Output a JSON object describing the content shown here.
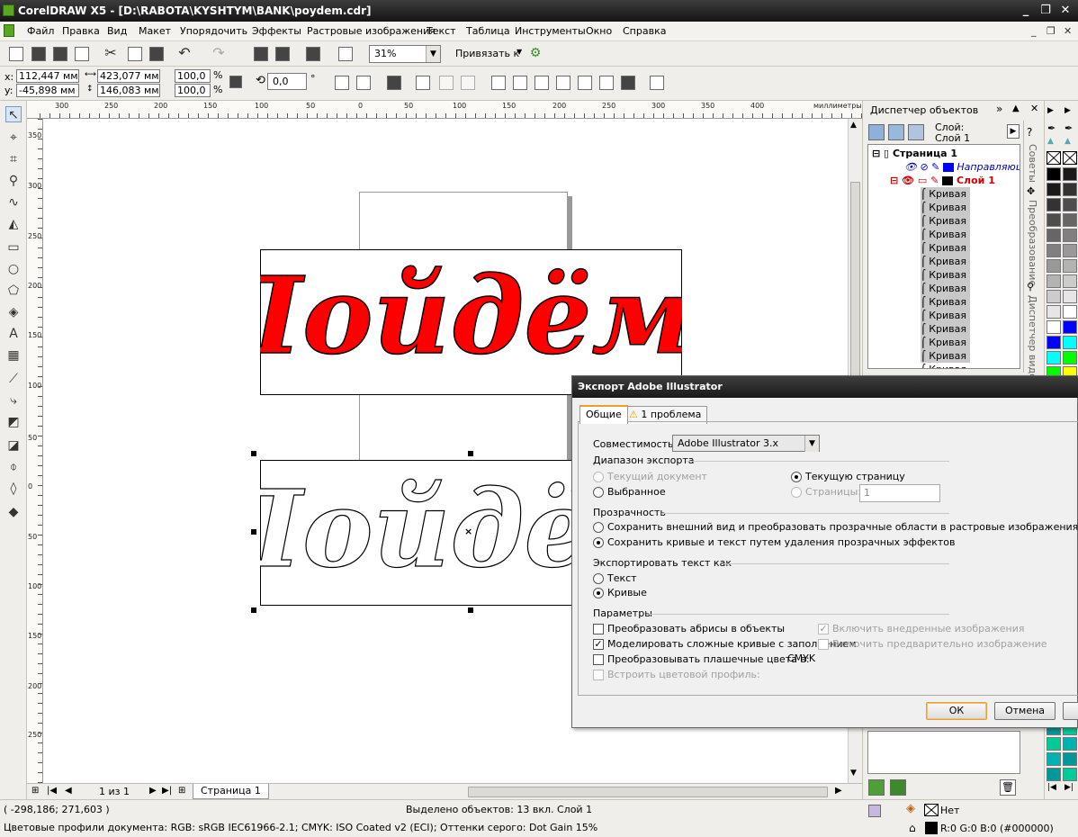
{
  "window": {
    "title": "CorelDRAW X5 - [D:\\RABOTA\\KYSHTYM\\BANK\\poydem.cdr]"
  },
  "menu": [
    "Файл",
    "Правка",
    "Вид",
    "Макет",
    "Упорядочить",
    "Эффекты",
    "Растровые изображения",
    "Текст",
    "Таблица",
    "Инструменты",
    "Окно",
    "Справка"
  ],
  "toolbar": {
    "zoom": "31%",
    "snap_label": "Привязать к"
  },
  "property_bar": {
    "x": "112,447 мм",
    "y": "-45,898 мм",
    "width": "423,077 мм",
    "height": "146,083 мм",
    "scale_x": "100,0",
    "scale_y": "100,0",
    "pct": "%",
    "angle": "0,0",
    "deg": "°"
  },
  "ruler": {
    "units": "миллиметры",
    "h_ticks": [
      "300",
      "250",
      "200",
      "150",
      "100",
      "50",
      "0",
      "50",
      "100",
      "150",
      "200",
      "250",
      "300",
      "350",
      "400"
    ],
    "v_ticks": [
      "350",
      "300",
      "250",
      "200",
      "150",
      "100",
      "50",
      "0",
      "50",
      "100",
      "150",
      "200",
      "250"
    ]
  },
  "canvas": {
    "artwork_text": "Пойдём!",
    "artwork_color": "#ff0000"
  },
  "page_nav": {
    "counter": "1 из 1",
    "page_tab": "Страница 1"
  },
  "status": {
    "coords": "( -298,186; 271,603 )",
    "selection": "Выделено объектов: 13 вкл. Слой 1",
    "profiles": "Цветовые профили документа: RGB: sRGB IEC61966-2.1; CMYK: ISO Coated v2 (ECI); Оттенки серого: Dot Gain 15%",
    "fill": "Нет",
    "outline": "R:0 G:0 B:0 (#000000)"
  },
  "object_manager": {
    "title": "Диспетчер объектов",
    "layer_header_line1": "Слой:",
    "layer_header_line2": "Слой 1",
    "page": "Страница 1",
    "guides_layer": "Направляющи",
    "layer": "Слой 1",
    "curve_label": "Кривая",
    "docker_tabs": [
      "Советы",
      "Преобразование",
      "Диспетчер видов"
    ]
  },
  "palette_colors": [
    "#000000",
    "#1a1a1a",
    "#333333",
    "#4d4d4d",
    "#666666",
    "#808080",
    "#999999",
    "#b3b3b3",
    "#cccccc",
    "#e6e6e6",
    "#ffffff",
    "#0000ff",
    "#00ffff",
    "#00ff00",
    "#ffff00",
    "#009999",
    "#00cc99",
    "#00b3b3"
  ],
  "dialog": {
    "title": "Экспорт Adobe Illustrator",
    "tab_general": "Общие",
    "tab_problems": "1 проблема",
    "compat_label": "Совместимость:",
    "compat_value": "Adobe Illustrator 3.x",
    "range_header": "Диапазон экспорта",
    "current_doc": "Текущий документ",
    "current_page": "Текущую страницу",
    "selected": "Выбранное",
    "pages": "Страницы:",
    "pages_value": "1",
    "transparency_header": "Прозрачность",
    "keep_appearance": "Сохранить внешний вид и преобразовать прозрачные области в растровые изображения",
    "keep_curves": "Сохранить кривые и текст путем удаления прозрачных эффектов",
    "export_text_header": "Экспортировать текст как",
    "text_opt": "Текст",
    "curves_opt": "Кривые",
    "params_header": "Параметры",
    "p1": "Преобразовать абрисы в объекты",
    "p2": "Моделировать сложные кривые с заполнением",
    "p3": "Преобразовывать плашечные цвета в:",
    "p3_value": "CMYK",
    "p4": "Встроить цветовой профиль:",
    "p5": "Включить внедренные изображения",
    "p6": "Включить предварительно изображение",
    "ok": "ОК",
    "cancel": "Отмена"
  }
}
